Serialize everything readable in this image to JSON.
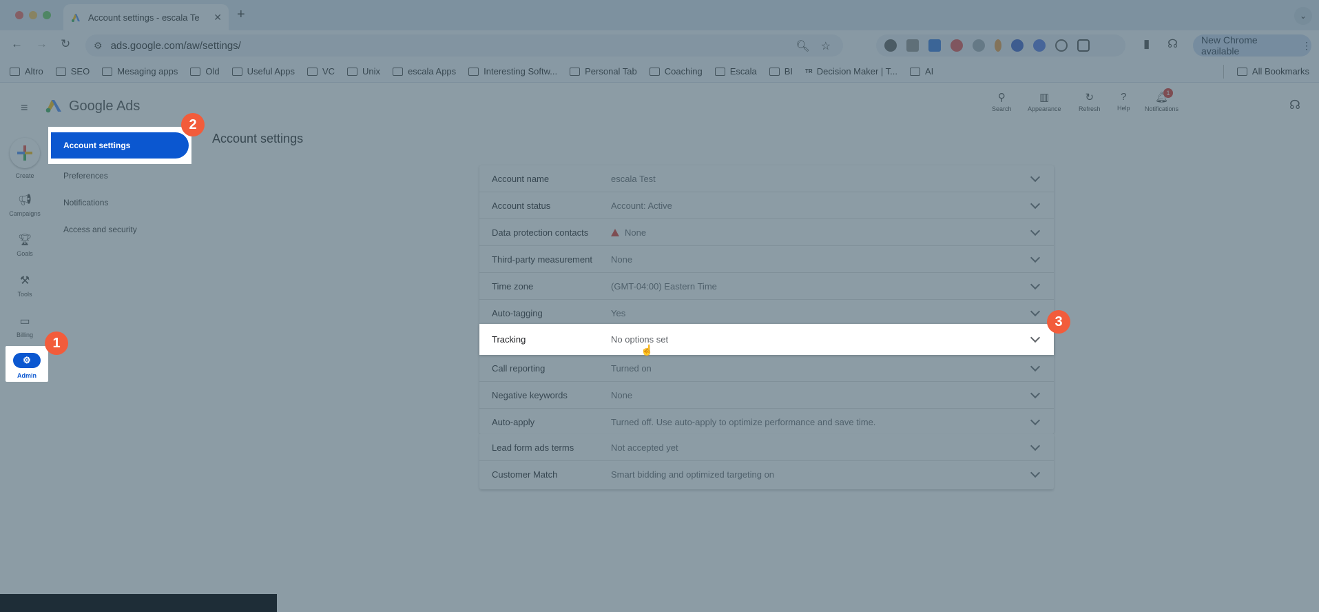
{
  "browser": {
    "tab_title": "Account settings - escala Te",
    "new_tab_symbol": "+",
    "url": "ads.google.com/aw/settings/",
    "new_chrome_label": "New Chrome available",
    "bookmarks": [
      "Altro",
      "SEO",
      "Mesaging apps",
      "Old",
      "Useful Apps",
      "VC",
      "Unix",
      "escala Apps",
      "Interesting Softw...",
      "Personal Tab",
      "Coaching",
      "Escala",
      "BI",
      "Decision Maker | T...",
      "AI"
    ],
    "all_bookmarks": "All Bookmarks"
  },
  "header": {
    "app_name": "Google Ads",
    "icons": [
      {
        "name": "search",
        "label": "Search"
      },
      {
        "name": "appearance",
        "label": "Appearance"
      },
      {
        "name": "refresh",
        "label": "Refresh"
      },
      {
        "name": "help",
        "label": "Help"
      },
      {
        "name": "notifications",
        "label": "Notifications",
        "badge": "1"
      }
    ]
  },
  "rail": {
    "create": "Create",
    "campaigns": "Campaigns",
    "goals": "Goals",
    "tools": "Tools",
    "billing": "Billing",
    "admin": "Admin"
  },
  "subnav": {
    "items": [
      "Account settings",
      "Preferences",
      "Notifications",
      "Access and security"
    ]
  },
  "page_title": "Account settings",
  "settings": [
    {
      "label": "Account name",
      "value": "escala Test"
    },
    {
      "label": "Account status",
      "value": "Account: Active"
    },
    {
      "label": "Data protection contacts",
      "value": "None",
      "warning": true
    },
    {
      "label": "Third-party measurement",
      "value": "None"
    },
    {
      "label": "Time zone",
      "value": "(GMT-04:00) Eastern Time"
    },
    {
      "label": "Auto-tagging",
      "value": "Yes"
    },
    {
      "label": "Tracking",
      "value": "No options set"
    },
    {
      "label": "Call reporting",
      "value": "Turned on"
    },
    {
      "label": "Negative keywords",
      "value": "None"
    },
    {
      "label": "Auto-apply",
      "value": "Turned off. Use auto-apply to optimize performance and save time."
    },
    {
      "label": "Lead form ads terms",
      "value": "Not accepted yet"
    },
    {
      "label": "Customer Match",
      "value": "Smart bidding and optimized targeting on"
    }
  ],
  "markers": [
    "1",
    "2",
    "3"
  ],
  "colors": {
    "accent": "#0b57d0",
    "marker": "#f25c3b",
    "overlay": "#465f6e"
  }
}
